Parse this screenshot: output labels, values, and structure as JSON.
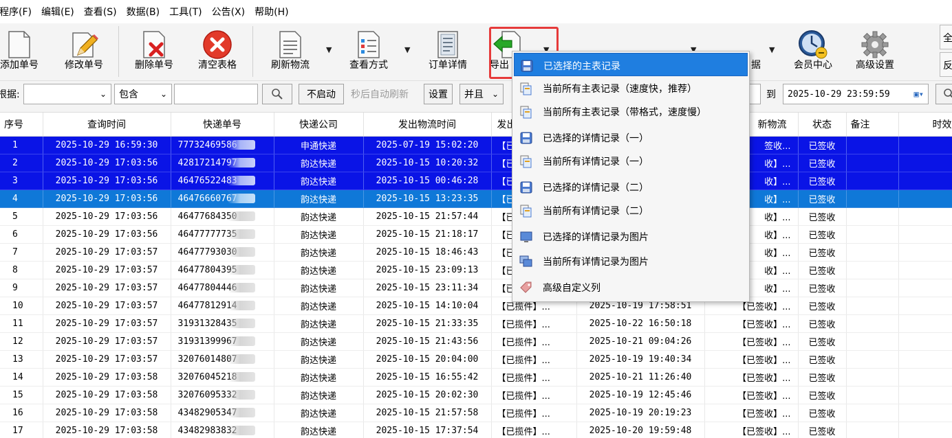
{
  "menubar": {
    "items": [
      "程序(F)",
      "编辑(E)",
      "查看(S)",
      "数据(B)",
      "工具(T)",
      "公告(X)",
      "帮助(H)"
    ]
  },
  "toolbar": {
    "buttons": [
      {
        "label": "添加单号",
        "icon": "add-document-icon"
      },
      {
        "label": "修改单号",
        "icon": "edit-pencil-icon"
      },
      {
        "label": "删除单号",
        "icon": "delete-document-icon"
      },
      {
        "label": "清空表格",
        "icon": "clear-red-x-icon"
      },
      {
        "label": "刷新物流",
        "icon": "refresh-document-icon"
      },
      {
        "label": "查看方式",
        "icon": "checklist-icon"
      },
      {
        "label": "订单详情",
        "icon": "order-detail-icon"
      },
      {
        "label": "导出",
        "icon": "export-green-arrow-icon"
      },
      {
        "label": "会员中心",
        "icon": "member-clock-icon"
      },
      {
        "label": "高级设置",
        "icon": "gear-icon"
      }
    ],
    "hidden_partial_labels": [
      "据"
    ],
    "right_edge": [
      "全",
      "反"
    ]
  },
  "filterbar": {
    "field_label": "根据:",
    "field_select": "",
    "op_select": "包含",
    "keyword": "",
    "search_icon": "magnifier-icon",
    "auto_button": "不启动",
    "auto_text": "秒后自动刷新",
    "settings_button": "设置",
    "logic_select": "并且",
    "to_label": "到",
    "end_date": "2025-10-29 23:59:59"
  },
  "table": {
    "columns": [
      "序号",
      "查询时间",
      "快递单号",
      "快递公司",
      "发出物流时间",
      "发出",
      "",
      "新物流",
      "状态",
      "备注",
      "时效"
    ],
    "rows": [
      {
        "no": "1",
        "query": "2025-10-29 16:59:30",
        "track": "77732469586",
        "company": "申通快递",
        "ship": "2025-07-19 15:02:20",
        "first": "【已",
        "latest_time": "",
        "latest": "签收...",
        "status": "已签收",
        "selected": "blue"
      },
      {
        "no": "2",
        "query": "2025-10-29 17:03:56",
        "track": "42817214797",
        "company": "韵达快递",
        "ship": "2025-10-15 10:20:32",
        "first": "【已",
        "latest_time": "",
        "latest": "收】...",
        "status": "已签收",
        "selected": "blue"
      },
      {
        "no": "3",
        "query": "2025-10-29 17:03:56",
        "track": "46476522483",
        "company": "韵达快递",
        "ship": "2025-10-15 00:46:28",
        "first": "【已",
        "latest_time": "",
        "latest": "收】...",
        "status": "已签收",
        "selected": "blue"
      },
      {
        "no": "4",
        "query": "2025-10-29 17:03:56",
        "track": "46476660767",
        "company": "韵达快递",
        "ship": "2025-10-15 13:23:35",
        "first": "【已",
        "latest_time": "",
        "latest": "收】...",
        "status": "已签收",
        "selected": "focus"
      },
      {
        "no": "5",
        "query": "2025-10-29 17:03:56",
        "track": "46477684350",
        "company": "韵达快递",
        "ship": "2025-10-15 21:57:44",
        "first": "【已",
        "latest_time": "",
        "latest": "收】...",
        "status": "已签收",
        "selected": "none"
      },
      {
        "no": "6",
        "query": "2025-10-29 17:03:56",
        "track": "46477777735",
        "company": "韵达快递",
        "ship": "2025-10-15 21:18:17",
        "first": "【已",
        "latest_time": "",
        "latest": "收】...",
        "status": "已签收",
        "selected": "none"
      },
      {
        "no": "7",
        "query": "2025-10-29 17:03:57",
        "track": "46477793030",
        "company": "韵达快递",
        "ship": "2025-10-15 18:46:43",
        "first": "【已",
        "latest_time": "",
        "latest": "收】...",
        "status": "已签收",
        "selected": "none"
      },
      {
        "no": "8",
        "query": "2025-10-29 17:03:57",
        "track": "46477804395",
        "company": "韵达快递",
        "ship": "2025-10-15 23:09:13",
        "first": "【已",
        "latest_time": "",
        "latest": "收】...",
        "status": "已签收",
        "selected": "none"
      },
      {
        "no": "9",
        "query": "2025-10-29 17:03:57",
        "track": "46477804446",
        "company": "韵达快递",
        "ship": "2025-10-15 23:11:34",
        "first": "【已",
        "latest_time": "",
        "latest": "收】...",
        "status": "已签收",
        "selected": "none"
      },
      {
        "no": "10",
        "query": "2025-10-29 17:03:57",
        "track": "46477812914",
        "company": "韵达快递",
        "ship": "2025-10-15 14:10:04",
        "first": "【已揽件】...",
        "latest_time": "2025-10-19 17:58:51",
        "latest": "【已签收】...",
        "status": "已签收",
        "selected": "none"
      },
      {
        "no": "11",
        "query": "2025-10-29 17:03:57",
        "track": "31931328435",
        "company": "韵达快递",
        "ship": "2025-10-15 21:33:35",
        "first": "【已揽件】...",
        "latest_time": "2025-10-22 16:50:18",
        "latest": "【已签收】...",
        "status": "已签收",
        "selected": "none"
      },
      {
        "no": "12",
        "query": "2025-10-29 17:03:57",
        "track": "31931399967",
        "company": "韵达快递",
        "ship": "2025-10-15 21:43:56",
        "first": "【已揽件】...",
        "latest_time": "2025-10-21 09:04:26",
        "latest": "【已签收】...",
        "status": "已签收",
        "selected": "none"
      },
      {
        "no": "13",
        "query": "2025-10-29 17:03:57",
        "track": "32076014807",
        "company": "韵达快递",
        "ship": "2025-10-15 20:04:00",
        "first": "【已揽件】...",
        "latest_time": "2025-10-19 19:40:34",
        "latest": "【已签收】...",
        "status": "已签收",
        "selected": "none"
      },
      {
        "no": "14",
        "query": "2025-10-29 17:03:58",
        "track": "32076045218",
        "company": "韵达快递",
        "ship": "2025-10-15 16:55:42",
        "first": "【已揽件】...",
        "latest_time": "2025-10-21 11:26:40",
        "latest": "【已签收】...",
        "status": "已签收",
        "selected": "none"
      },
      {
        "no": "15",
        "query": "2025-10-29 17:03:58",
        "track": "32076095332",
        "company": "韵达快递",
        "ship": "2025-10-15 20:02:30",
        "first": "【已揽件】...",
        "latest_time": "2025-10-19 12:45:46",
        "latest": "【已签收】...",
        "status": "已签收",
        "selected": "none"
      },
      {
        "no": "16",
        "query": "2025-10-29 17:03:58",
        "track": "43482905347",
        "company": "韵达快递",
        "ship": "2025-10-15 21:57:58",
        "first": "【已揽件】...",
        "latest_time": "2025-10-19 20:19:23",
        "latest": "【已签收】...",
        "status": "已签收",
        "selected": "none"
      },
      {
        "no": "17",
        "query": "2025-10-29 17:03:58",
        "track": "43482983832",
        "company": "韵达快递",
        "ship": "2025-10-15 17:37:54",
        "first": "【已揽件】...",
        "latest_time": "2025-10-20 19:59:48",
        "latest": "【已签收】...",
        "status": "已签收",
        "selected": "none"
      }
    ]
  },
  "context_menu": {
    "items": [
      {
        "label": "已选择的主表记录",
        "icon": "save-disk-icon",
        "highlighted": true
      },
      {
        "label": "当前所有主表记录（速度快，推荐）",
        "icon": "copy-docs-icon"
      },
      {
        "label": "当前所有主表记录（带格式，速度慢）",
        "icon": "copy-docs-icon"
      },
      {
        "label": "已选择的详情记录（一）",
        "icon": "save-disk-icon"
      },
      {
        "label": "当前所有详情记录（一）",
        "icon": "copy-docs-icon"
      },
      {
        "label": "已选择的详情记录（二）",
        "icon": "save-disk-icon"
      },
      {
        "label": "当前所有详情记录（二）",
        "icon": "copy-docs-icon"
      },
      {
        "label": "已选择的详情记录为图片",
        "icon": "image-monitor-icon"
      },
      {
        "label": "当前所有详情记录为图片",
        "icon": "image-stack-icon"
      },
      {
        "label": "高级自定义列",
        "icon": "tag-icon"
      }
    ]
  },
  "colors": {
    "selection_blue": "#0a14e6",
    "focus_blue": "#0f78d8",
    "menu_highlight": "#1f7ee0",
    "export_outline": "#e63a3a"
  }
}
